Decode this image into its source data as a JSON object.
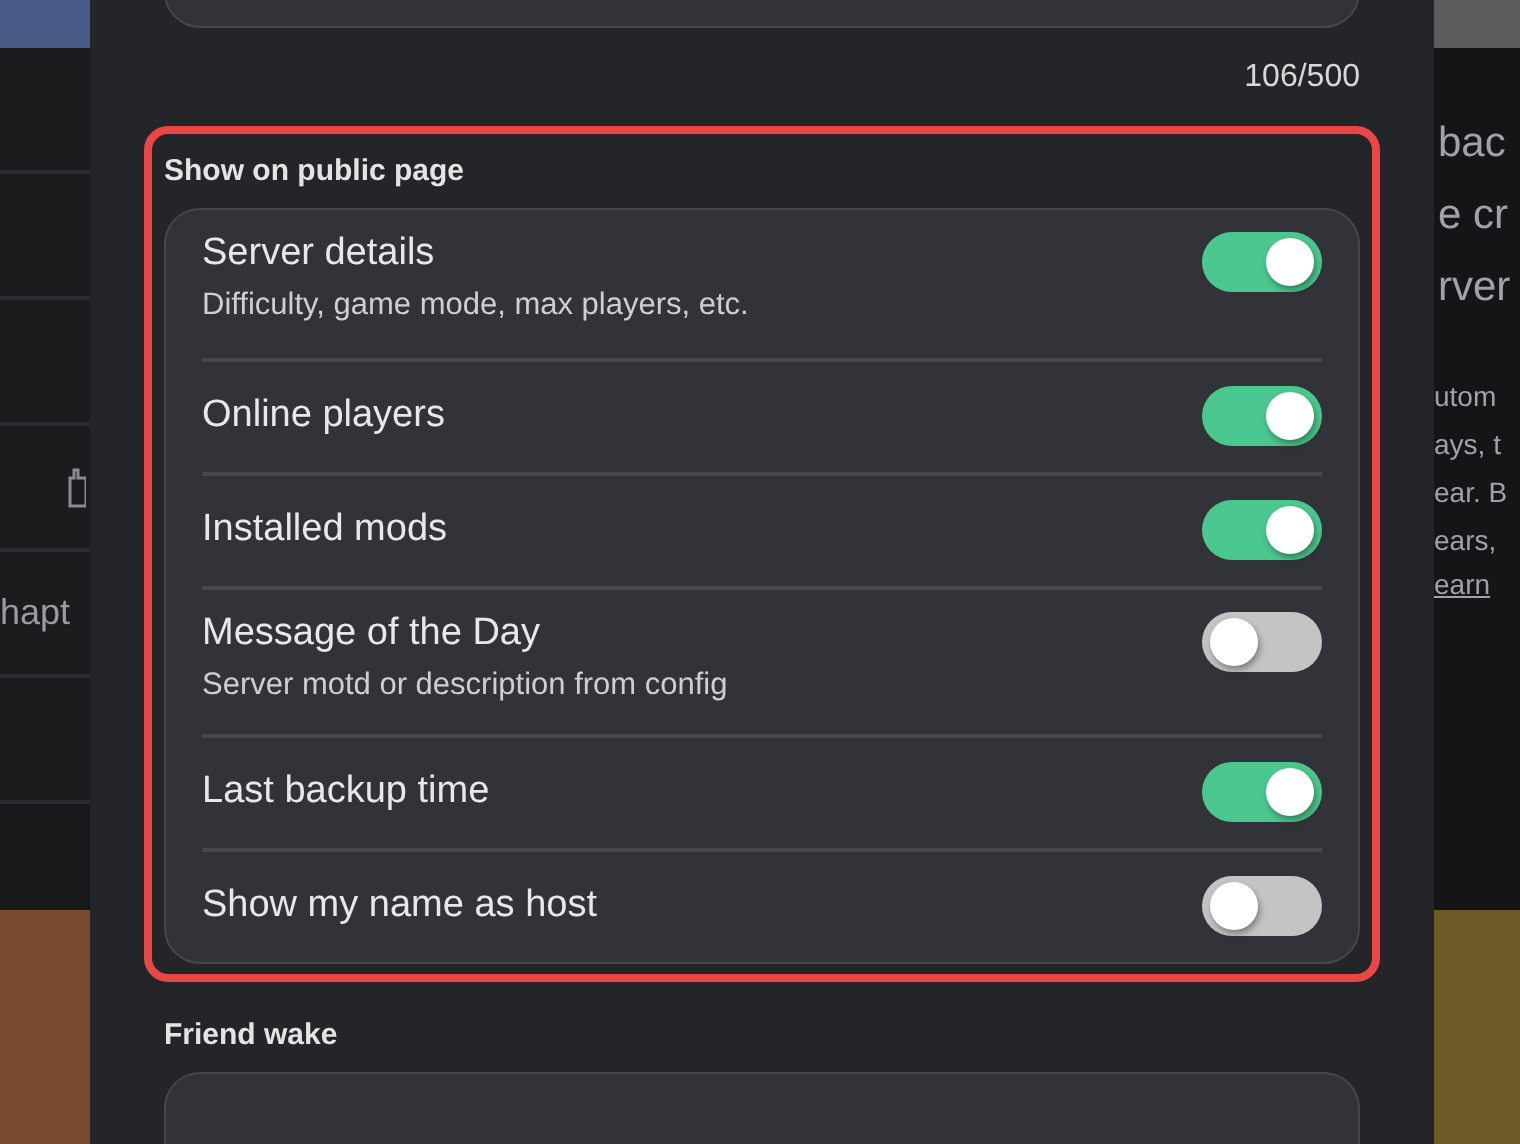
{
  "background": {
    "left_text": "hapt",
    "right_lines": [
      "bac",
      "e cr",
      "rver",
      "utom",
      "ays, t",
      "ear. B",
      "ears,"
    ],
    "right_link": "earn"
  },
  "description_field": {
    "counter": "106/500"
  },
  "public_page": {
    "title": "Show on public page",
    "highlighted": true,
    "options": [
      {
        "label": "Server details",
        "description": "Difficulty, game mode, max players, etc.",
        "on": true
      },
      {
        "label": "Online players",
        "on": true
      },
      {
        "label": "Installed mods",
        "on": true
      },
      {
        "label": "Message of the Day",
        "description": "Server motd or description from config",
        "on": false
      },
      {
        "label": "Last backup time",
        "on": true
      },
      {
        "label": "Show my name as host",
        "on": false
      }
    ]
  },
  "friend_wake": {
    "title": "Friend wake"
  }
}
